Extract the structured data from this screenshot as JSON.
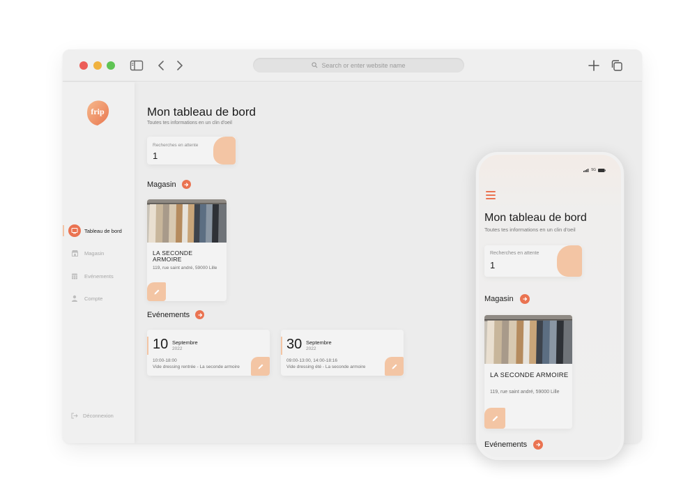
{
  "browser": {
    "url_placeholder": "Search or enter website name"
  },
  "brand": {
    "logo_text": "frip",
    "accent": "#ea7351",
    "peach": "#f3c5a4"
  },
  "sidebar": {
    "items": [
      {
        "label": "Tableau de bord",
        "icon": "dashboard-icon",
        "active": true
      },
      {
        "label": "Magasin",
        "icon": "store-icon"
      },
      {
        "label": "Evénements",
        "icon": "calendar-icon"
      },
      {
        "label": "Compte",
        "icon": "user-icon"
      }
    ],
    "logout": "Déconnexion"
  },
  "dashboard": {
    "title": "Mon tableau de bord",
    "subtitle": "Toutes tes informations en un clin d'oeil",
    "stat": {
      "label": "Recherches en attente",
      "value": "1"
    },
    "store_section": "Magasin",
    "store": {
      "name": "LA SECONDE ARMOIRE",
      "address": "119, rue saint andré, 59000 Lille"
    },
    "events_section": "Evénements",
    "events": [
      {
        "day": "10",
        "month": "Septembre",
        "year": "2022",
        "hours": "10:00-18:00",
        "desc": "Vide dressing rentrée - La seconde armoire"
      },
      {
        "day": "30",
        "month": "Septembre",
        "year": "2022",
        "hours": "09:00-13:00, 14:00-18:16",
        "desc": "Vide dressing été - La seconde armoire"
      }
    ]
  },
  "phone": {
    "status": "5G"
  }
}
